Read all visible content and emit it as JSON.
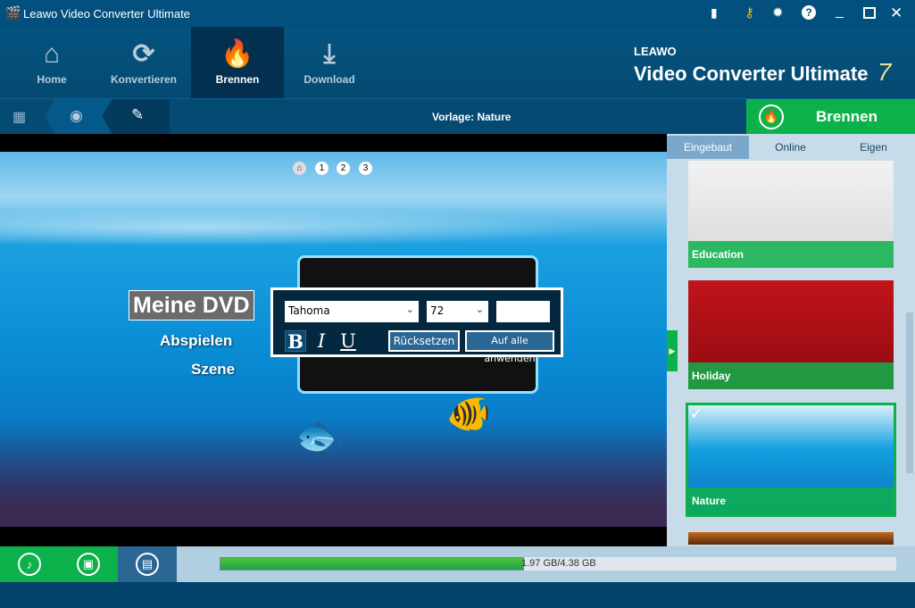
{
  "app": {
    "title": "Leawo Video Converter Ultimate"
  },
  "nav": [
    {
      "label": "Home",
      "icon": "home-icon"
    },
    {
      "label": "Konvertieren",
      "icon": "convert-icon"
    },
    {
      "label": "Brennen",
      "icon": "flame-icon"
    },
    {
      "label": "Download",
      "icon": "download-icon"
    }
  ],
  "brand": {
    "top": "LEAWO",
    "name": "Video Converter Ultimate",
    "version": "7"
  },
  "toolbar": {
    "template_label": "Vorlage: Nature",
    "burn_label": "Brennen"
  },
  "preview": {
    "pages": [
      "1",
      "2",
      "3"
    ],
    "title": "Meine DVD",
    "menu_items": [
      "Abspielen",
      "Szene"
    ]
  },
  "editor": {
    "font": "Tahoma",
    "size": "72",
    "color_value": "",
    "bold": "B",
    "italic": "I",
    "underline": "U",
    "reset": "Rücksetzen",
    "apply_all": "Auf alle anwenden"
  },
  "sidebar": {
    "tabs": [
      "Eingebaut",
      "Online",
      "Eigen"
    ],
    "templates": [
      "Education",
      "Holiday",
      "Nature"
    ],
    "selected": "Nature"
  },
  "storage": {
    "text": "1.97 GB/4.38 GB",
    "used_fraction": 0.45
  },
  "colors": {
    "accent_green": "#0db14b",
    "dark_blue": "#02416a"
  }
}
